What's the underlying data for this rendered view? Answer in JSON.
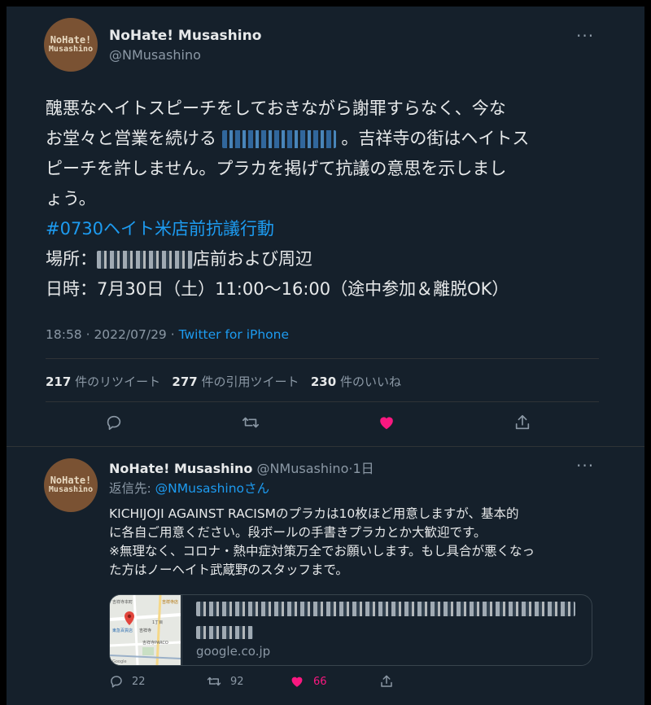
{
  "tweet": {
    "display_name": "NoHate! Musashino",
    "handle": "@NMusashino",
    "avatar_line1": "NoHate!",
    "avatar_line2": "Musashino",
    "text_line1": "醜悪なヘイトスピーチをしておきながら謝罪すらなく、今な",
    "text_line2a": "お堂々と営業を続ける",
    "text_line2b": "。吉祥寺の街はヘイトス",
    "text_line3": "ピーチを許しません。プラカを掲げて抗議の意思を示しまし",
    "text_line4": "ょう。",
    "hashtag": "#0730ヘイト米店前抗議行動",
    "place_label": "場所：",
    "place_suffix": "店前および周辺",
    "datetime_text": "日時：7月30日（土）11:00〜16:00（途中参加＆離脱OK）",
    "timestamp": "18:58 · 2022/07/29 · ",
    "source": "Twitter for iPhone",
    "retweets_count": "217",
    "retweets_label": "件のリツイート",
    "quotes_count": "277",
    "quotes_label": "件の引用ツイート",
    "likes_count": "230",
    "likes_label": "件のいいね"
  },
  "reply": {
    "display_name": "NoHate! Musashino",
    "handle_time": "@NMusashino·1日",
    "replying_prefix": "返信先: ",
    "replying_to": "@NMusashinoさん",
    "line1": "KICHIJOJI AGAINST RACISMのプラカは10枚ほど用意しますが、基本的",
    "line2": "に各自ご用意ください。段ボールの手書きプラカとか大歓迎です。",
    "line3": "※無理なく、コロナ・熱中症対策万全でお願いします。もし具合が悪くなっ",
    "line4": "た方はノーヘイト武蔵野のスタッフまで。",
    "card_domain": "google.co.jp",
    "reply_count": "22",
    "retweet_count": "92",
    "like_count": "66"
  },
  "map_labels": {
    "station": "吉祥寺",
    "street": "吉祥寺本町",
    "store1": "東急百貨店",
    "store2": "吉祥寺PARCO",
    "block": "1丁目",
    "shop": "吉祥寺店",
    "brand": "Google"
  },
  "colors": {
    "background": "#15202b",
    "accent": "#1d9bf0",
    "like": "#f91880",
    "muted": "#8b98a5"
  }
}
